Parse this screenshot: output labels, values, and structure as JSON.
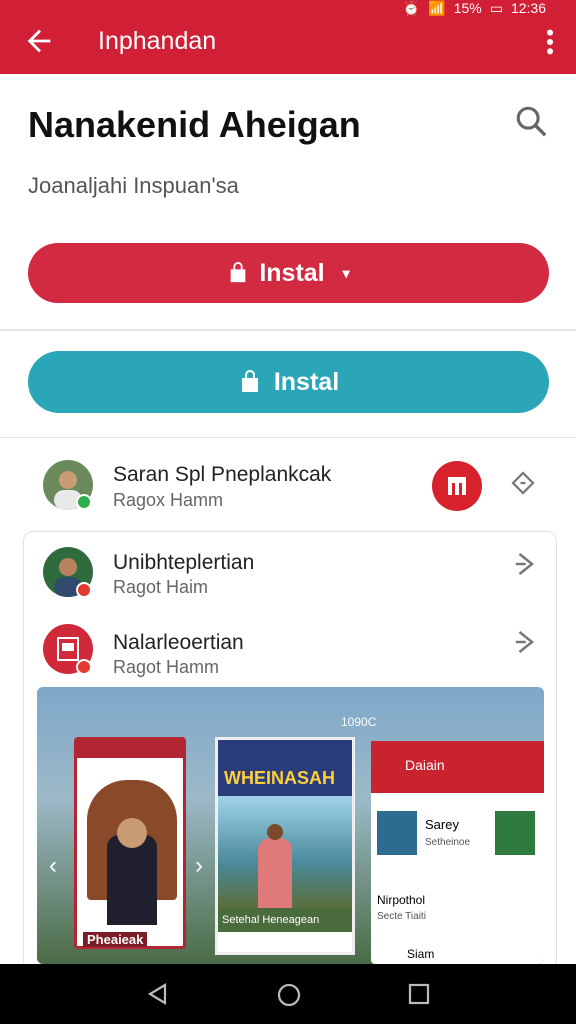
{
  "status_bar": {
    "battery": "15%",
    "time": "12:36"
  },
  "header": {
    "title": "Inphandan"
  },
  "app": {
    "name": "Nanakenid Aheigan",
    "subtitle": "Joanaljahi Inspuan'sa"
  },
  "buttons": {
    "primary_label": "Instal",
    "secondary_label": "Instal"
  },
  "list": [
    {
      "title": "Saran Spl Pneplankcak",
      "subtitle": "Ragox Hamm"
    },
    {
      "title": "Unibhteplertian",
      "subtitle": "Ragot Haim"
    },
    {
      "title": "Nalarleoertian",
      "subtitle": "Ragot Hamm"
    }
  ],
  "gallery": {
    "left_card_title": "Pheaieak",
    "center_top": "WHEINASAH",
    "center_caption": "Setehal Heneagean",
    "right_header": "Daiain",
    "right_item1_title": "Sarey",
    "right_item1_sub": "Setheinoe",
    "right_item2_title": "Nirpothol",
    "right_item2_sub": "Secte Tiaiti",
    "right_item3_title": "Siam",
    "right_timer": "1090C"
  },
  "colors": {
    "accent_red": "#d11f35",
    "accent_teal": "#2ba6b8"
  }
}
